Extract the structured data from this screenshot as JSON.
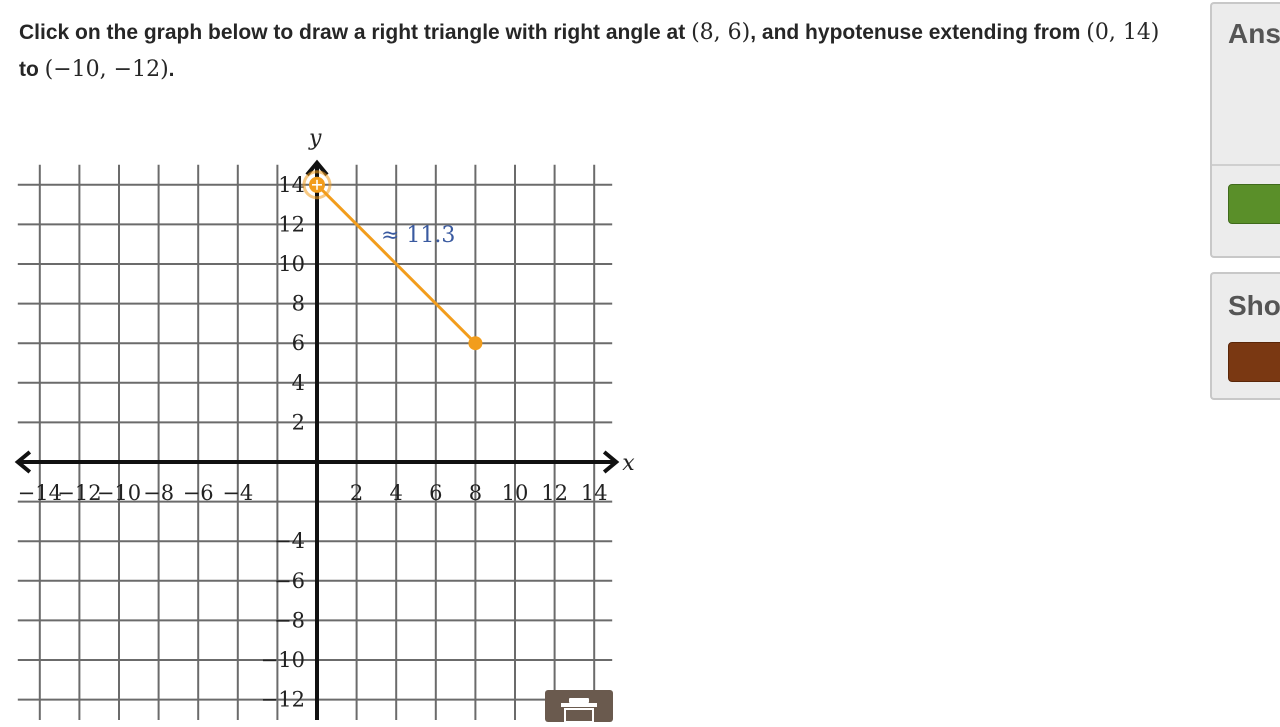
{
  "question": {
    "text_1": "Click on the graph below to draw a right triangle with right angle at ",
    "math_1": "(8, 6)",
    "text_2": ", and hypotenuse extending from ",
    "math_2": "(0, 14)",
    "text_3": " to ",
    "math_3": "(−10, −12)",
    "text_4": "."
  },
  "graph": {
    "x_axis_label": "x",
    "y_axis_label": "y",
    "x_range": [
      -14,
      14
    ],
    "y_range": [
      -14,
      14
    ],
    "tick_step": 2,
    "x_tick_labels": [
      {
        "value": -14,
        "label": "−14"
      },
      {
        "value": -12,
        "label": "−12"
      },
      {
        "value": -10,
        "label": "−10"
      },
      {
        "value": -8,
        "label": "−8"
      },
      {
        "value": -6,
        "label": "−6"
      },
      {
        "value": -4,
        "label": "−4"
      },
      {
        "value": 2,
        "label": "2"
      },
      {
        "value": 4,
        "label": "4"
      },
      {
        "value": 6,
        "label": "6"
      },
      {
        "value": 8,
        "label": "8"
      },
      {
        "value": 10,
        "label": "10"
      },
      {
        "value": 12,
        "label": "12"
      },
      {
        "value": 14,
        "label": "14"
      }
    ],
    "y_tick_labels": [
      {
        "value": 14,
        "label": "14"
      },
      {
        "value": 12,
        "label": "12"
      },
      {
        "value": 10,
        "label": "10"
      },
      {
        "value": 8,
        "label": "8"
      },
      {
        "value": 6,
        "label": "6"
      },
      {
        "value": 4,
        "label": "4"
      },
      {
        "value": 2,
        "label": "2"
      },
      {
        "value": -4,
        "label": "−4"
      },
      {
        "value": -6,
        "label": "−6"
      },
      {
        "value": -8,
        "label": "−8"
      },
      {
        "value": -10,
        "label": "−10"
      },
      {
        "value": -12,
        "label": "−12"
      }
    ],
    "segment": {
      "from": [
        0,
        14
      ],
      "to": [
        8,
        6
      ],
      "length_label": "≈ 11.3",
      "color": "#f29d1c",
      "label_color": "#3a5aa0"
    },
    "drag_handle_point": [
      0,
      14
    ]
  },
  "answer_panel": {
    "title": "Ans",
    "check_button_color": "#5a8f29"
  },
  "show_panel": {
    "title": "Sho",
    "hint_button_color": "#7a3812"
  },
  "trash_icon": "trash-icon",
  "move_icon": "move-crosshair-icon"
}
